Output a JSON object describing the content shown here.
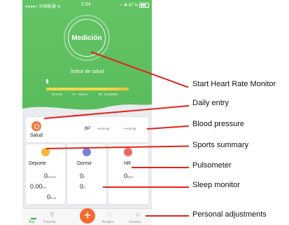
{
  "status": {
    "carrier": "●●●●○ 中国联通 ≋",
    "time": "2:54",
    "battery": "⌁ ✱ 87 %"
  },
  "hero": {
    "button_label": "Medición",
    "index_label": "Índice de salud",
    "scale": [
      "Normal",
      "Bueno",
      "Excelente"
    ],
    "scale_values": [
      "70",
      "90"
    ]
  },
  "salud": {
    "title": "Salud",
    "bp_label": "BP",
    "bp_sys": "--",
    "bp_sys_unit": "mmHg",
    "bp_dia": "--",
    "bp_dia_unit": "mmHg"
  },
  "deporte": {
    "title": "Deporte",
    "steps": "0",
    "steps_unit": "Pasos",
    "distance": "0.00",
    "distance_unit": "km",
    "calories": "0",
    "calories_unit": "kcal"
  },
  "dormir": {
    "title": "Dormir",
    "hours": "0",
    "hours_unit": "h",
    "minutes": "0",
    "minutes_unit": "m"
  },
  "hr": {
    "title": "HR",
    "value": "0",
    "unit": "bpm"
  },
  "tabs": [
    "Hoy",
    "Deporte",
    "+",
    "Amigos",
    "Usuario"
  ],
  "annotations": {
    "start_hr": "Start Heart Rate Monitor",
    "daily": "Daily entry",
    "bp": "Blood pressure",
    "sports": "Sports summary",
    "pulsometer": "Pulsometer",
    "sleep": "Sleep monitor",
    "personal": "Personal adjustments"
  },
  "colors": {
    "green": "#5cbf5f",
    "orange": "#f36a2f",
    "annotation": "#e2231a"
  }
}
